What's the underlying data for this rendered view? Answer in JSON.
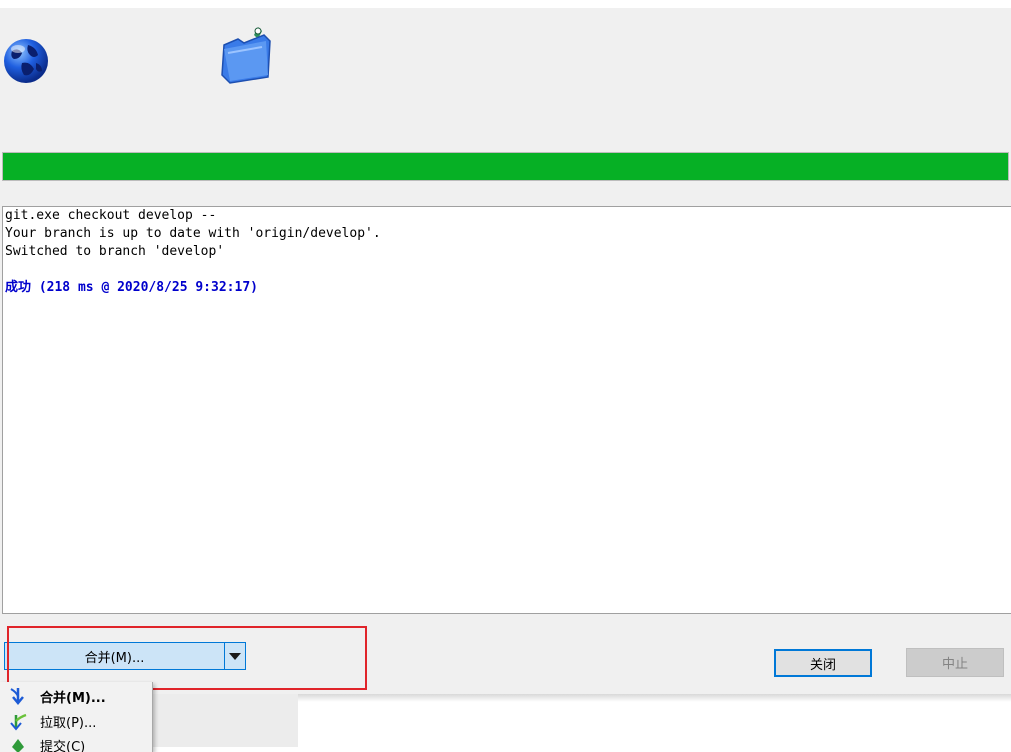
{
  "progress": {
    "percent": 100,
    "color": "#06b025"
  },
  "icons": {
    "globe": "globe-icon",
    "folder": "folder-icon"
  },
  "log": {
    "lines": [
      "git.exe checkout develop --",
      "Your branch is up to date with 'origin/develop'.",
      "Switched to branch 'develop'"
    ],
    "status": "成功 (218 ms @ 2020/8/25 9:32:17)",
    "status_color": "#0000cc"
  },
  "action_button": {
    "label": "合并(M)...",
    "arrow_icon": "chevron-down-icon"
  },
  "buttons": {
    "close": "关闭",
    "abort": "中止"
  },
  "menu": {
    "items": [
      {
        "label": "合并(M)...",
        "icon": "merge-icon",
        "default": true
      },
      {
        "label": "拉取(P)...",
        "icon": "pull-icon",
        "default": false
      },
      {
        "label": "提交(C)",
        "icon": "commit-icon",
        "default": false
      }
    ]
  }
}
